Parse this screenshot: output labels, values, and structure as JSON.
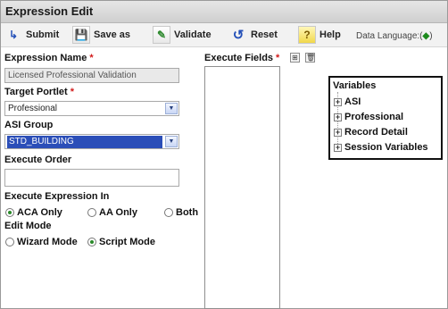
{
  "window": {
    "title": "Expression Edit"
  },
  "toolbar": {
    "submit": "Submit",
    "save_as": "Save as",
    "validate": "Validate",
    "reset": "Reset",
    "help": "Help",
    "data_language": "Data Language:(",
    "data_language_indicator": "◆",
    "data_language_close": ")"
  },
  "form": {
    "expression_name": {
      "label": "Expression Name",
      "value": "Licensed Professional Validation"
    },
    "target_portlet": {
      "label": "Target Portlet",
      "value": "Professional"
    },
    "asi_group": {
      "label": "ASI Group",
      "value": "STD_BUILDING"
    },
    "execute_order": {
      "label": "Execute Order",
      "value": ""
    },
    "execute_in": {
      "label": "Execute Expression In",
      "options": [
        "ACA Only",
        "AA Only",
        "Both"
      ],
      "selected": "ACA Only"
    },
    "edit_mode": {
      "label": "Edit Mode",
      "options": [
        "Wizard Mode",
        "Script Mode"
      ],
      "selected": "Script Mode"
    },
    "required_mark": "*"
  },
  "execute_fields": {
    "label": "Execute Fields",
    "items": []
  },
  "variables": {
    "title": "Variables",
    "items": [
      "ASI",
      "Professional",
      "Record Detail",
      "Session Variables"
    ]
  }
}
